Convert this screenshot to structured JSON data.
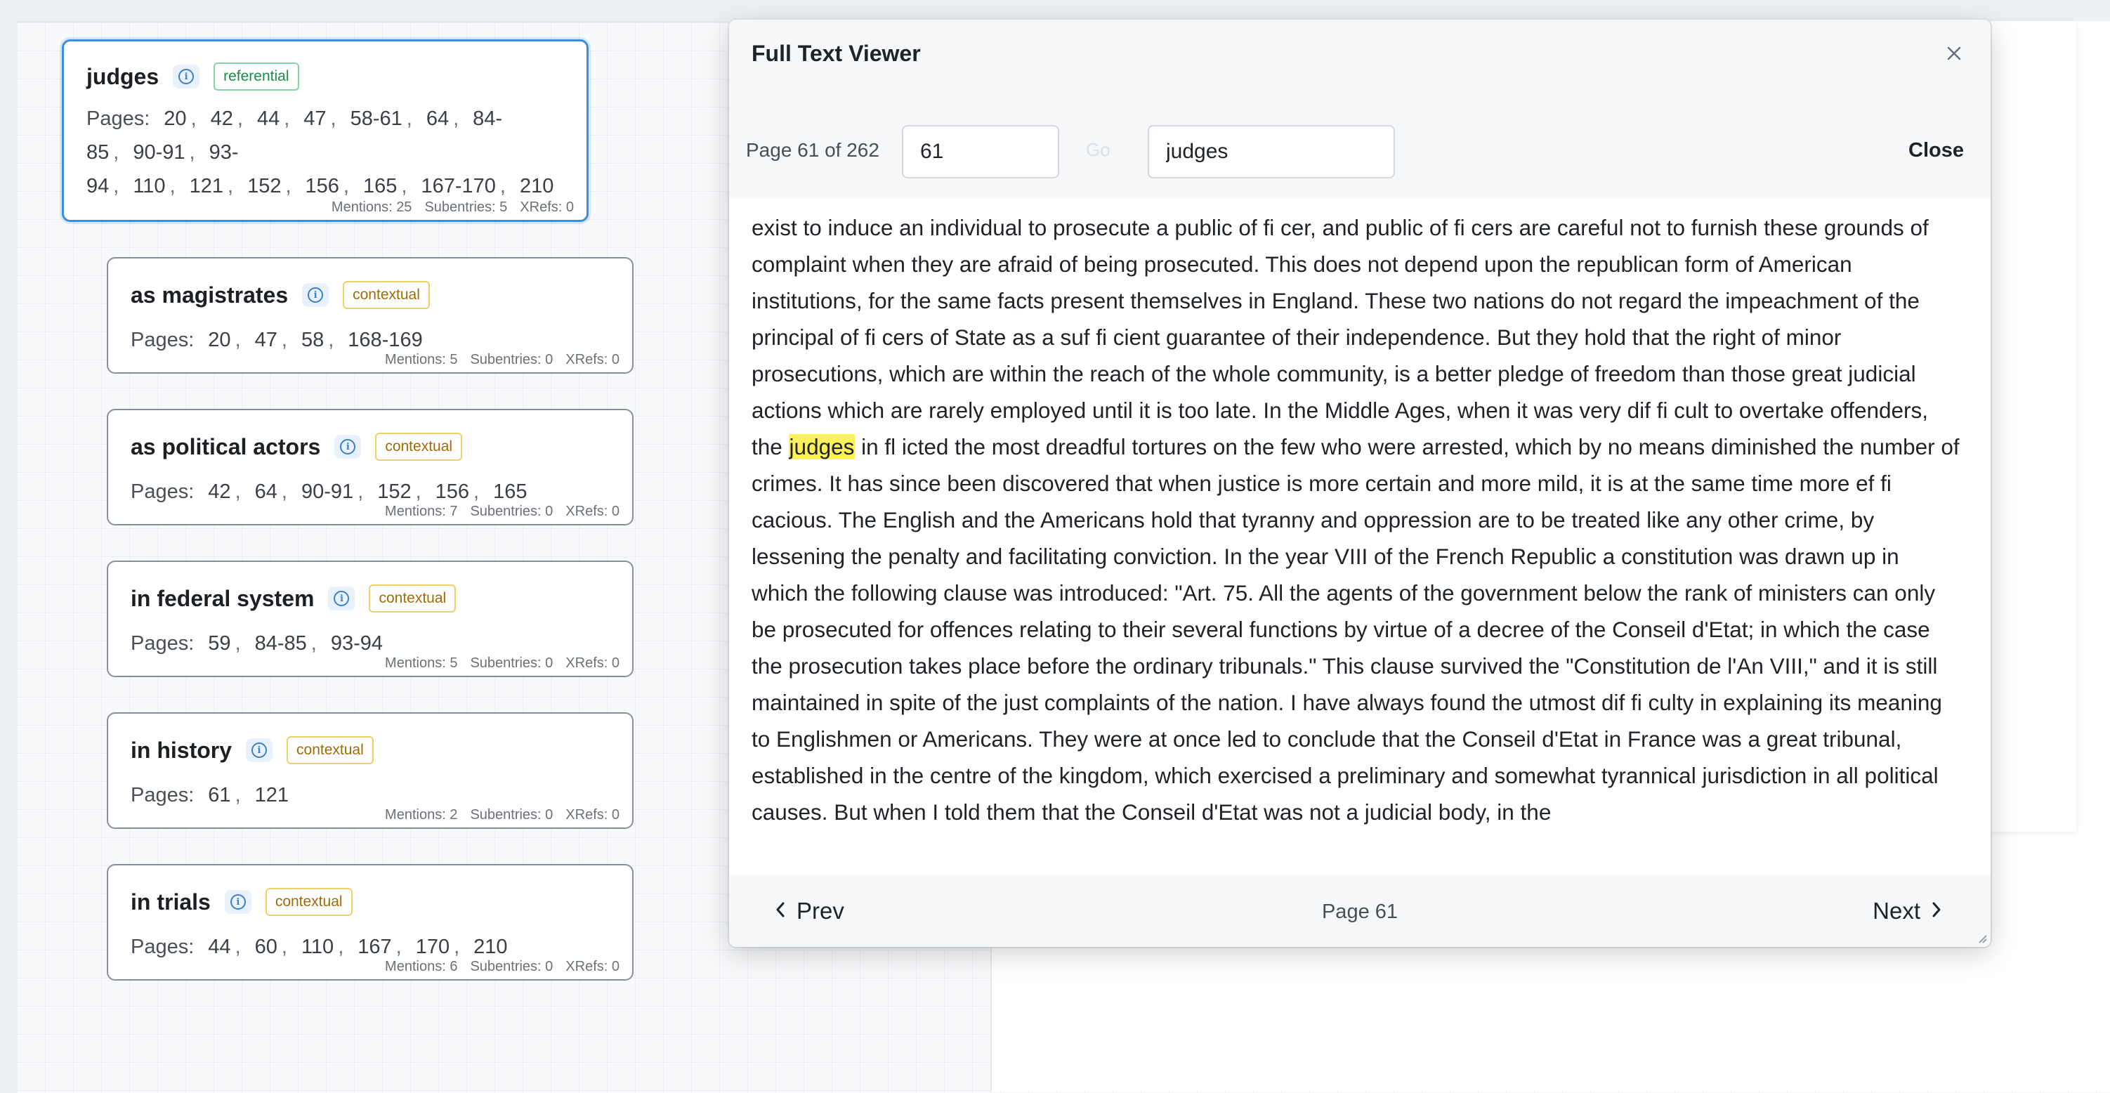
{
  "index_cards": [
    {
      "title": "judges",
      "tag": "referential",
      "pages_label": "Pages:",
      "pages": [
        "20",
        "42",
        "44",
        "47",
        "58-61",
        "64",
        "84-85",
        "90-91",
        "93-94",
        "110",
        "121",
        "152",
        "156",
        "165",
        "167-170",
        "210"
      ],
      "mentions": "Mentions: 25",
      "subentries": "Subentries: 5",
      "xrefs": "XRefs: 0"
    },
    {
      "title": "as magistrates",
      "tag": "contextual",
      "pages_label": "Pages:",
      "pages": [
        "20",
        "47",
        "58",
        "168-169"
      ],
      "mentions": "Mentions: 5",
      "subentries": "Subentries: 0",
      "xrefs": "XRefs: 0"
    },
    {
      "title": "as political actors",
      "tag": "contextual",
      "pages_label": "Pages:",
      "pages": [
        "42",
        "64",
        "90-91",
        "152",
        "156",
        "165"
      ],
      "mentions": "Mentions: 7",
      "subentries": "Subentries: 0",
      "xrefs": "XRefs: 0"
    },
    {
      "title": "in federal system",
      "tag": "contextual",
      "pages_label": "Pages:",
      "pages": [
        "59",
        "84-85",
        "93-94"
      ],
      "mentions": "Mentions: 5",
      "subentries": "Subentries: 0",
      "xrefs": "XRefs: 0"
    },
    {
      "title": "in history",
      "tag": "contextual",
      "pages_label": "Pages:",
      "pages": [
        "61",
        "121"
      ],
      "mentions": "Mentions: 2",
      "subentries": "Subentries: 0",
      "xrefs": "XRefs: 0"
    },
    {
      "title": "in trials",
      "tag": "contextual",
      "pages_label": "Pages:",
      "pages": [
        "44",
        "60",
        "110",
        "167",
        "170",
        "210"
      ],
      "mentions": "Mentions: 6",
      "subentries": "Subentries: 0",
      "xrefs": "XRefs: 0"
    }
  ],
  "viewer": {
    "title": "Full Text Viewer",
    "page_indicator": "Page 61 of 262",
    "page_input_value": "61",
    "go_label": "Go",
    "search_value": "judges",
    "close_label": "Close",
    "text_before": "exist to induce an individual to prosecute a public of fi cer, and public of fi cers are careful not to furnish these grounds of complaint when they are afraid of being prosecuted. This does not depend upon the republican form of American institutions, for the same facts present themselves in England. These two nations do not regard the impeachment of the principal of fi cers of State as a suf fi cient guarantee of their independence. But they hold that the right of minor prosecutions, which are within the reach of the whole community, is a better pledge of freedom than those great judicial actions which are rarely employed until it is too late. In the Middle Ages, when it was very dif fi cult to overtake offenders, the ",
    "highlight": "judges",
    "text_after": " in fl icted the most dreadful tortures on the few who were arrested, which by no means diminished the number of crimes. It has since been discovered that when justice is more certain and more mild, it is at the same time more ef fi cacious. The English and the Americans hold that tyranny and oppression are to be treated like any other crime, by lessening the penalty and facilitating conviction. In the year VIII of the French Republic a constitution was drawn up in which the following clause was introduced: \"Art. 75. All the agents of the government below the rank of ministers can only be prosecuted for offences relating to their several functions by virtue of a decree of the Conseil d'Etat; in which the case the prosecution takes place before the ordinary tribunals.\" This clause survived the \"Constitution de l'An VIII,\" and it is still maintained in spite of the just complaints of the nation. I have always found the utmost dif fi culty in explaining its meaning to Englishmen or Americans. They were at once led to conclude that the Conseil d'Etat in France was a great tribunal, established in the centre of the kingdom, which exercised a preliminary and somewhat tyrannical jurisdiction in all political causes. But when I told them that the Conseil d'Etat was not a judicial body, in the",
    "prev_label": "Prev",
    "next_label": "Next",
    "footer_page": "Page 61"
  },
  "icons": {
    "info": "info-icon",
    "close": "close-icon",
    "prev": "chevron-left-icon",
    "next": "chevron-right-icon",
    "resize": "resize-handle-icon"
  },
  "colors": {
    "highlight": "#fcf15a",
    "selected_card_border": "#3b8fd9",
    "referential_tag": "#1e8a4a",
    "contextual_tag": "#a16a07"
  }
}
